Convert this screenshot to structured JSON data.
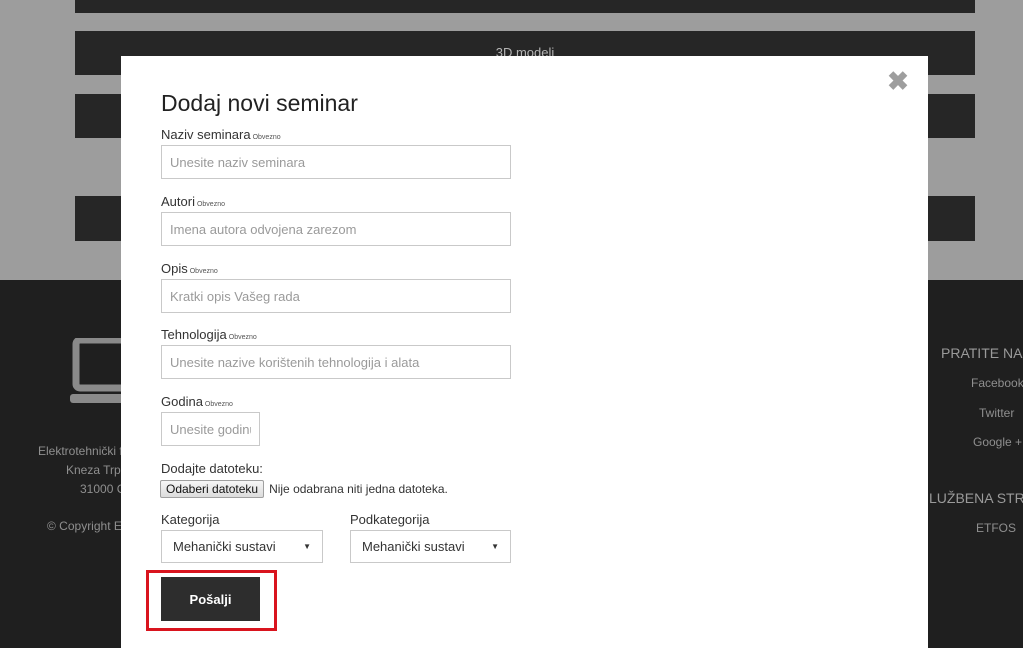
{
  "background": {
    "nav_bars": [
      "",
      "3D modeli",
      "",
      ""
    ],
    "footer": {
      "address_line1": "Elektrotehnički f",
      "address_line2": "Kneza Trpi",
      "address_line3": "31000 C",
      "copyright": "© Copyright E",
      "follow_heading": "PRATITE NA",
      "social_links": [
        "Facebook",
        "Twitter",
        "Google +"
      ],
      "official_heading": "LUŽBENA STR",
      "official_links": [
        "ETFOS"
      ]
    }
  },
  "modal": {
    "title": "Dodaj novi seminar",
    "required_tag": "Obvezno",
    "fields": {
      "naziv": {
        "label": "Naziv seminara",
        "placeholder": "Unesite naziv seminara",
        "value": ""
      },
      "autori": {
        "label": "Autori",
        "placeholder": "Imena autora odvojena zarezom",
        "value": ""
      },
      "opis": {
        "label": "Opis",
        "placeholder": "Kratki opis Vašeg rada",
        "value": ""
      },
      "tehnologija": {
        "label": "Tehnologija",
        "placeholder": "Unesite nazive korištenih tehnologija i alata",
        "value": ""
      },
      "godina": {
        "label": "Godina",
        "placeholder": "Unesite godinu",
        "value": ""
      }
    },
    "file": {
      "label": "Dodajte datoteku:",
      "button": "Odaberi datoteku",
      "status": "Nije odabrana niti jedna datoteka."
    },
    "kategorija": {
      "label": "Kategorija",
      "selected": "Mehanički sustavi"
    },
    "podkategorija": {
      "label": "Podkategorija",
      "selected": "Mehanički sustavi"
    },
    "submit_label": "Pošalji",
    "close_icon": "close-icon",
    "highlight_color": "#d9141e"
  }
}
